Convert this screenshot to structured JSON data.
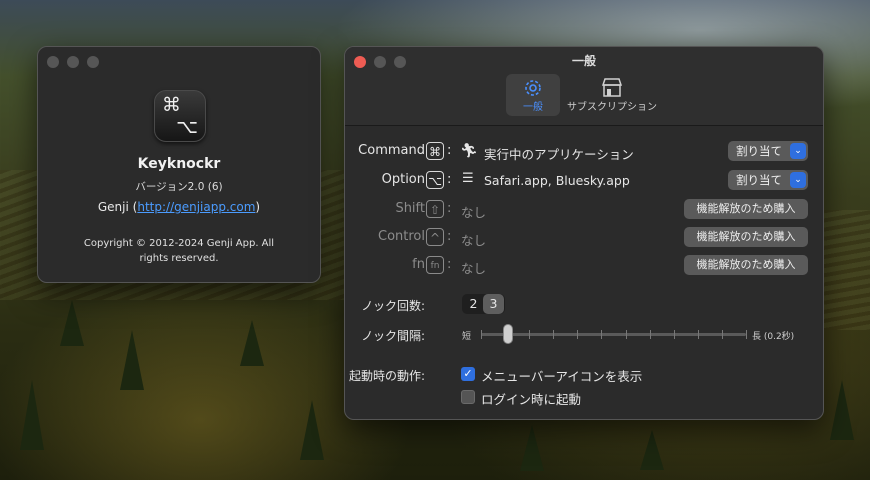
{
  "about": {
    "app_name": "Keyknockr",
    "version": "バージョン2.0 (6)",
    "developer": "Genji",
    "url": "http://genjiapp.com",
    "copyright": "Copyright © 2012-2024 Genji App. All rights reserved.",
    "icon_glyphs": [
      "⌘",
      "⌥"
    ]
  },
  "settings": {
    "title": "一般",
    "tabs": [
      {
        "label": "一般",
        "icon": "gear-icon",
        "active": true
      },
      {
        "label": "サブスクリプション",
        "icon": "storefront-icon",
        "active": false
      }
    ],
    "keys": [
      {
        "name": "Command",
        "glyph": "⌘",
        "app_icon": "running-figure-icon",
        "target": "実行中のアプリケーション",
        "action": "割り当て",
        "enabled": true
      },
      {
        "name": "Option",
        "glyph": "⌥",
        "app_icon": "list-icon",
        "target": "Safari.app, Bluesky.app",
        "action": "割り当て",
        "enabled": true
      },
      {
        "name": "Shift",
        "glyph": "⇧",
        "target": "なし",
        "action": "機能解放のため購入",
        "enabled": false
      },
      {
        "name": "Control",
        "glyph": "^",
        "target": "なし",
        "action": "機能解放のため購入",
        "enabled": false
      },
      {
        "name": "fn",
        "glyph": "fn",
        "target": "なし",
        "action": "機能解放のため購入",
        "enabled": false
      }
    ],
    "knock_count": {
      "label": "ノック回数:",
      "options": [
        "2",
        "3"
      ],
      "selected": "3"
    },
    "knock_interval": {
      "label": "ノック間隔:",
      "min_label": "短",
      "max_label": "長 (0.2秒)",
      "value": 0.1,
      "ticks": 12
    },
    "startup": {
      "label": "起動時の動作:",
      "options": [
        {
          "label": "メニューバーアイコンを表示",
          "checked": true
        },
        {
          "label": "ログイン時に起動",
          "checked": false
        }
      ]
    }
  },
  "colors": {
    "accent": "#2f6fdf",
    "link": "#4b9cff",
    "close": "#ee5c53"
  }
}
